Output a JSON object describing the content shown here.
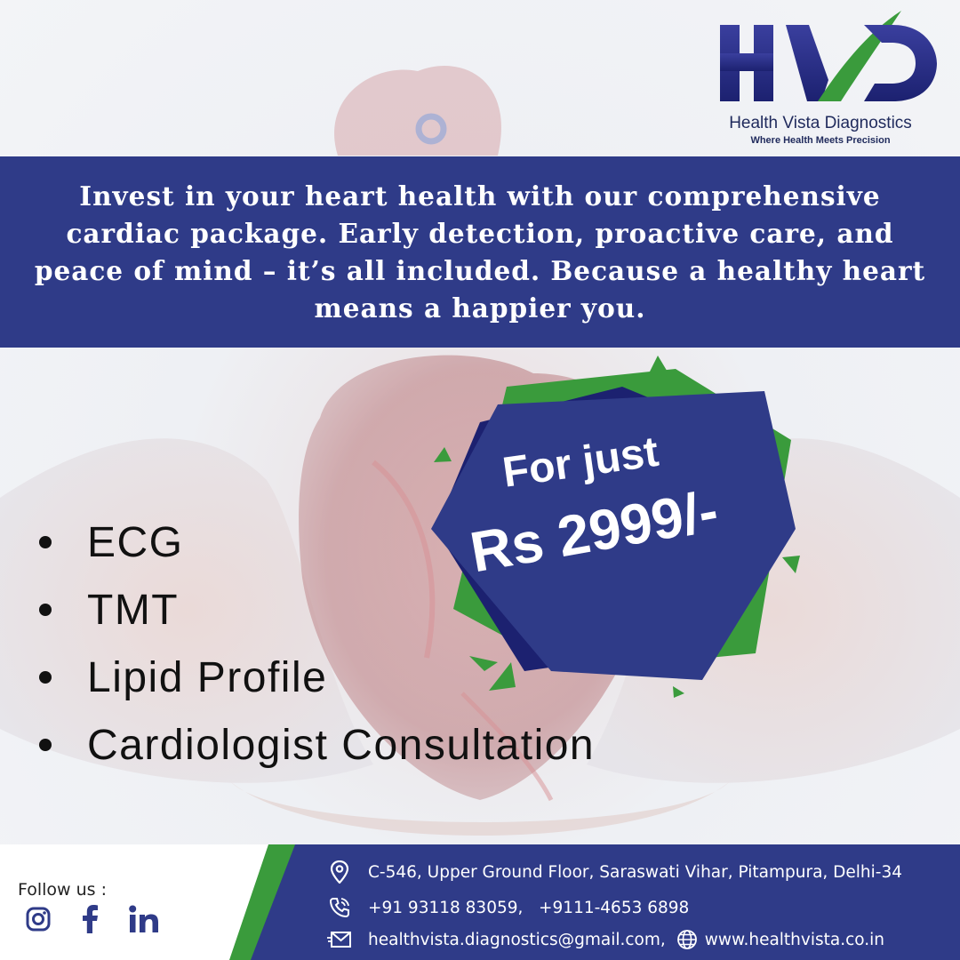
{
  "brand": {
    "name": "Health Vista Diagnostics",
    "tagline": "Where Health Meets Precision",
    "colors": {
      "navy": "#2f3b88",
      "green": "#3a9b3c",
      "dark_navy": "#1f2a5c"
    }
  },
  "intro": {
    "text": "Invest in your heart health with our comprehensive cardiac package. Early detection, proactive care, and peace of mind – it’s all included. Because a healthy heart means a happier you."
  },
  "offer": {
    "label": "For just",
    "price": "Rs 2999/-"
  },
  "tests": [
    {
      "label": "ECG"
    },
    {
      "label": "TMT"
    },
    {
      "label": "Lipid Profile"
    },
    {
      "label": "Cardiologist Consultation"
    }
  ],
  "footer": {
    "follow_label": "Follow us :",
    "social": [
      "instagram-icon",
      "facebook-icon",
      "linkedin-icon"
    ],
    "address": "C-546, Upper Ground Floor, Saraswati Vihar, Pitampura, Delhi-34",
    "phones": "+91 93118 83059,   +9111-4653 6898",
    "email": "healthvista.diagnostics@gmail.com,",
    "website": "www.healthvista.co.in"
  }
}
